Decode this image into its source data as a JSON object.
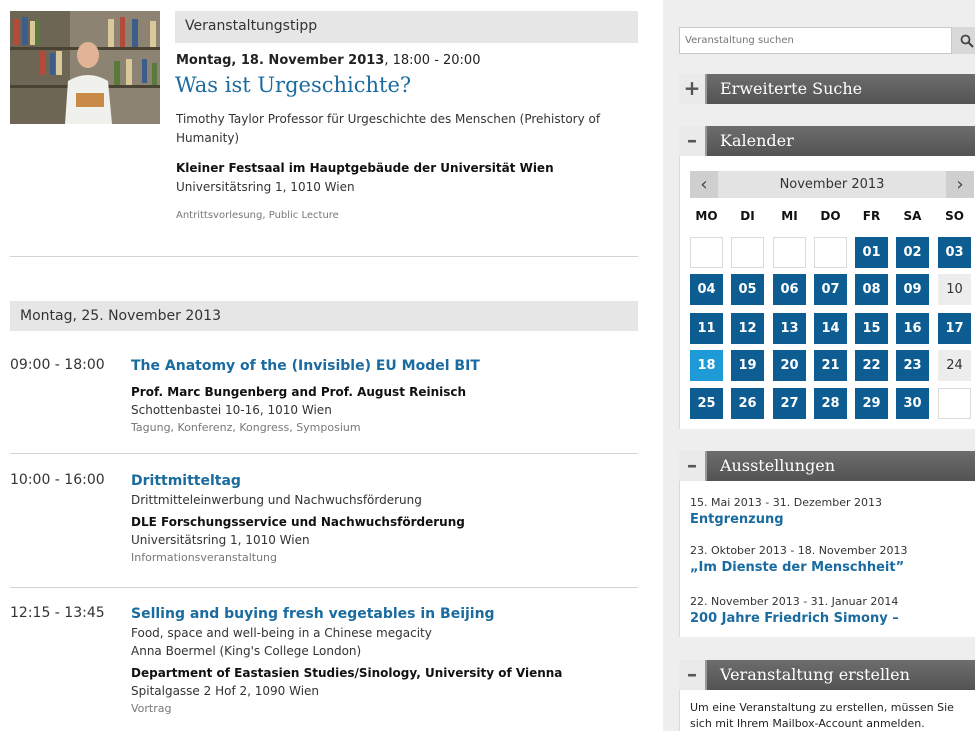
{
  "tip": {
    "section_label": "Veranstaltungstipp",
    "date": "Montag, 18. November 2013",
    "time": ", 18:00 - 20:00",
    "title": "Was ist Urgeschichte?",
    "description": "Timothy Taylor Professor für Urgeschichte des Menschen (Prehistory of Humanity)",
    "venue": "Kleiner Festsaal im Hauptgebäude der Universität Wien",
    "address": "Universitätsring 1, 1010 Wien",
    "tags": "Antrittsvorlesung, Public Lecture"
  },
  "day_heading": "Montag, 25. November 2013",
  "events": [
    {
      "time": "09:00 - 18:00",
      "title": "The Anatomy of the (Invisible) EU Model BIT",
      "subtitle": "",
      "speaker": "",
      "organizer": "Prof. Marc Bungenberg and Prof. August Reinisch",
      "address": "Schottenbastei 10-16, 1010 Wien",
      "tags": "Tagung, Konferenz, Kongress, Symposium"
    },
    {
      "time": "10:00 - 16:00",
      "title": "Drittmitteltag",
      "subtitle": "Drittmitteleinwerbung und Nachwuchsförderung",
      "speaker": "",
      "organizer": "DLE Forschungsservice und Nachwuchsförderung",
      "address": "Universitätsring 1, 1010 Wien",
      "tags": "Informationsveranstaltung"
    },
    {
      "time": "12:15 - 13:45",
      "title": "Selling and buying fresh vegetables in Beijing",
      "subtitle": "Food, space and well-being in a Chinese megacity",
      "speaker": "Anna Boermel (King's College London)",
      "organizer": "Department of Eastasien Studies/Sinology, University of Vienna",
      "address": "Spitalgasse 2 Hof 2, 1090 Wien",
      "tags": "Vortrag"
    }
  ],
  "search": {
    "placeholder": "Veranstaltung suchen",
    "icon": "search-icon"
  },
  "panels": {
    "advanced_search": {
      "toggle": "+",
      "title": "Erweiterte Suche"
    },
    "calendar": {
      "toggle": "–",
      "title": "Kalender"
    },
    "exhibitions": {
      "toggle": "–",
      "title": "Ausstellungen"
    },
    "create": {
      "toggle": "–",
      "title": "Veranstaltung erstellen"
    }
  },
  "calendar": {
    "month_label": "November 2013",
    "prev": "‹",
    "next": "›",
    "weekdays": [
      "MO",
      "DI",
      "MI",
      "DO",
      "FR",
      "SA",
      "SO"
    ],
    "weeks": [
      [
        {
          "d": "",
          "t": "empty"
        },
        {
          "d": "",
          "t": "empty"
        },
        {
          "d": "",
          "t": "empty"
        },
        {
          "d": "",
          "t": "empty"
        },
        {
          "d": "01",
          "t": "ev"
        },
        {
          "d": "02",
          "t": "ev"
        },
        {
          "d": "03",
          "t": "ev"
        }
      ],
      [
        {
          "d": "04",
          "t": "ev"
        },
        {
          "d": "05",
          "t": "ev"
        },
        {
          "d": "06",
          "t": "ev"
        },
        {
          "d": "07",
          "t": "ev"
        },
        {
          "d": "08",
          "t": "ev"
        },
        {
          "d": "09",
          "t": "ev"
        },
        {
          "d": "10",
          "t": "plain"
        }
      ],
      [
        {
          "d": "11",
          "t": "ev"
        },
        {
          "d": "12",
          "t": "ev"
        },
        {
          "d": "13",
          "t": "ev"
        },
        {
          "d": "14",
          "t": "ev"
        },
        {
          "d": "15",
          "t": "ev"
        },
        {
          "d": "16",
          "t": "ev"
        },
        {
          "d": "17",
          "t": "ev"
        }
      ],
      [
        {
          "d": "18",
          "t": "today"
        },
        {
          "d": "19",
          "t": "ev"
        },
        {
          "d": "20",
          "t": "ev"
        },
        {
          "d": "21",
          "t": "ev"
        },
        {
          "d": "22",
          "t": "ev"
        },
        {
          "d": "23",
          "t": "ev"
        },
        {
          "d": "24",
          "t": "plain"
        }
      ],
      [
        {
          "d": "25",
          "t": "ev"
        },
        {
          "d": "26",
          "t": "ev"
        },
        {
          "d": "27",
          "t": "ev"
        },
        {
          "d": "28",
          "t": "ev"
        },
        {
          "d": "29",
          "t": "ev"
        },
        {
          "d": "30",
          "t": "ev"
        },
        {
          "d": "",
          "t": "empty"
        }
      ]
    ]
  },
  "exhibitions": [
    {
      "dates": "15. Mai 2013 - 31. Dezember 2013",
      "title": "Entgrenzung"
    },
    {
      "dates": "23. Oktober 2013 - 18. November 2013",
      "title": "„Im Dienste der Menschheit”"
    },
    {
      "dates": "22. November 2013 - 31. Januar 2014",
      "title": "200 Jahre Friedrich Simony –"
    }
  ],
  "create_text": "Um eine Veranstaltung zu erstellen, müssen Sie sich mit Ihrem Mailbox-Account anmelden."
}
